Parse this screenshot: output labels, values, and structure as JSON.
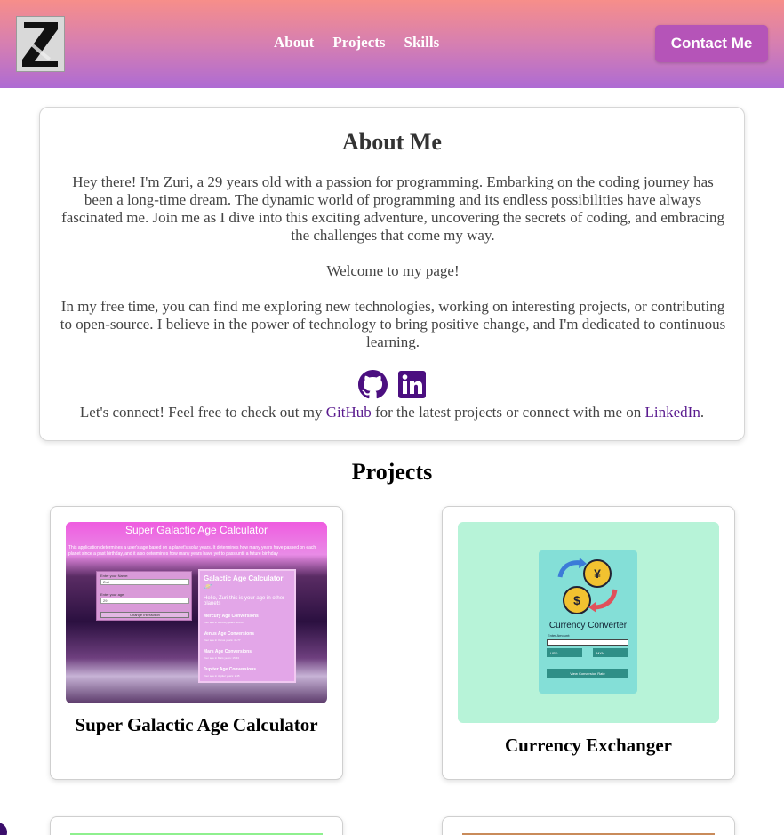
{
  "header": {
    "logo_letter": "Z",
    "nav": [
      {
        "label": "About"
      },
      {
        "label": "Projects"
      },
      {
        "label": "Skills"
      }
    ],
    "contact_label": "Contact Me",
    "colors": {
      "gradient_top": "#f78e8a",
      "gradient_bottom": "#ae6bd3",
      "contact_button": "#b554b8"
    }
  },
  "about": {
    "title": "About Me",
    "paragraph1": "Hey there! I'm Zuri, a 29 years old with a passion for programming. Embarking on the coding journey has been a long-time dream. The dynamic world of programming and its endless possibilities have always fascinated me. Join me as I dive into this exciting adventure, uncovering the secrets of coding, and embracing the challenges that come my way.",
    "paragraph2": "Welcome to my page!",
    "paragraph3": "In my free time, you can find me exploring new technologies, working on interesting projects, or contributing to open-source. I believe in the power of technology to bring positive change, and I'm dedicated to continuous learning.",
    "icons": [
      "github-icon",
      "linkedin-icon"
    ],
    "connect_prefix": "Let's connect! Feel free to check out my ",
    "github_link": "GitHub",
    "connect_middle": " for the latest projects or connect with me on ",
    "linkedin_link": "LinkedIn",
    "connect_suffix": ".",
    "link_color": "#5a1b8f"
  },
  "projects": {
    "title": "Projects",
    "items": [
      {
        "name": "Super Galactic Age Calculator",
        "thumb": {
          "title": "Super Galactic Age Calculator",
          "desc": "This application determines a user's age based on a planet's solar years. It determines how many years have passed on each planet since a past birthday, and it also determines how many years have yet to pass until a future birthday",
          "name_label": "Enter your Name:",
          "name_value": "Zuri",
          "age_label": "Enter your age:",
          "age_value": "29",
          "button": "Change Interaction",
          "result_title": "Galactic Age Calculator 🪐",
          "result_sub": "Hello, Zuri this is your age in other planets",
          "results": [
            {
              "label": "Mercury Age Conversions",
              "value": "Your age in Mercury years: 120.83"
            },
            {
              "label": "Venus Age Conversions",
              "value": "Your age in Venus years: 46.77"
            },
            {
              "label": "Mars Age Conversions",
              "value": "Your age in Mars years: 15.43"
            },
            {
              "label": "Jupiter Age Conversions",
              "value": "Your age in Jupiter years: 2.45"
            }
          ]
        }
      },
      {
        "name": "Currency Exchanger",
        "thumb": {
          "title": "Currency Converter",
          "amount_label": "Enter Amount:",
          "from": "USD",
          "to": "MXN",
          "button": "View Conversion Rate"
        }
      }
    ]
  }
}
